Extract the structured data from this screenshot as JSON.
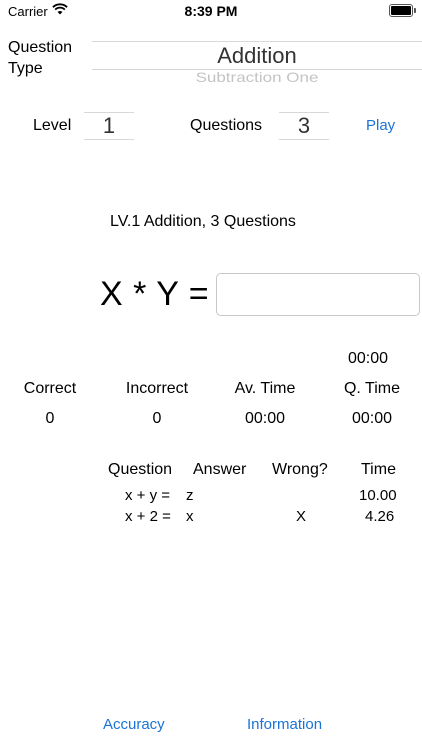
{
  "status_bar": {
    "carrier": "Carrier",
    "time": "8:39 PM",
    "icons": [
      "wifi-icon",
      "battery-icon"
    ]
  },
  "question_type": {
    "label": "Question Type",
    "selected": "Addition",
    "next_option": "Subtraction One"
  },
  "settings": {
    "level_label": "Level",
    "level_value": "1",
    "questions_label": "Questions",
    "questions_value": "3",
    "play_label": "Play"
  },
  "summary": "LV.1 Addition, 3 Questions",
  "problem": {
    "expression": "X * Y =",
    "answer_value": ""
  },
  "timer": "00:00",
  "stats": {
    "headers": [
      "Correct",
      "Incorrect",
      "Av. Time",
      "Q. Time"
    ],
    "values": [
      "0",
      "0",
      "00:00",
      "00:00"
    ]
  },
  "history": {
    "headers": {
      "question": "Question",
      "answer": "Answer",
      "wrong": "Wrong?",
      "time": "Time"
    },
    "rows": [
      {
        "question": "x + y =",
        "answer": "z",
        "wrong": "",
        "time": "10.00"
      },
      {
        "question": "x + 2 =",
        "answer": "x",
        "wrong": "X",
        "time": "4.26"
      }
    ]
  },
  "bottom_nav": {
    "accuracy": "Accuracy",
    "information": "Information"
  },
  "colors": {
    "accent": "#1a73d9",
    "separator": "#d8d8d8"
  }
}
